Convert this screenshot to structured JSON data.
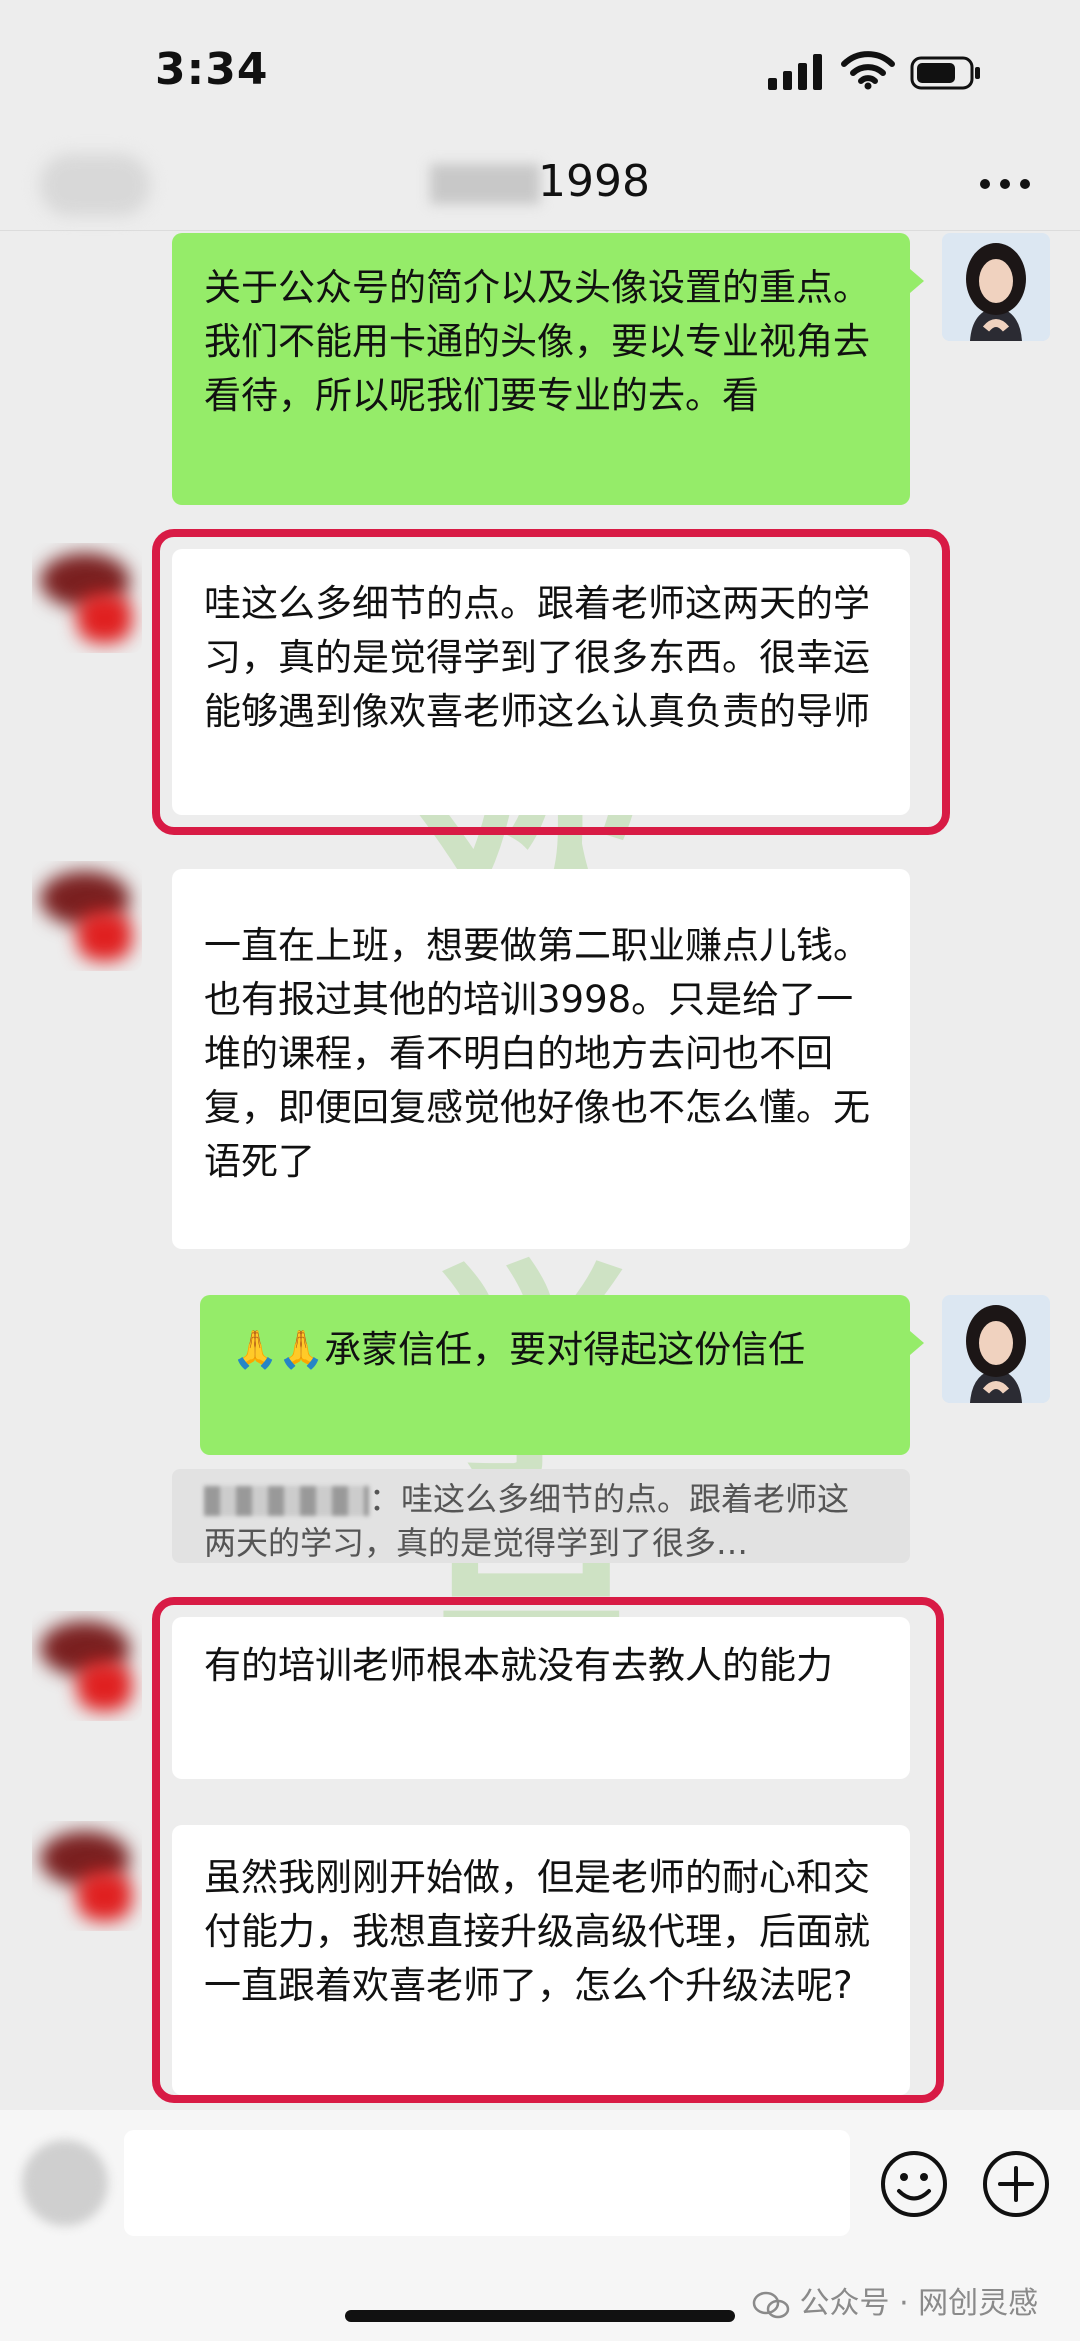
{
  "status_bar": {
    "time": "3:34"
  },
  "header": {
    "title": "1998"
  },
  "messages": [
    {
      "side": "right",
      "text": "关于公众号的简介以及头像设置的重点。我们不能用卡通的头像，要以专业视角去看待，所以呢我们要专业的去。看"
    },
    {
      "side": "left",
      "text": "哇这么多细节的点。跟着老师这两天的学习，真的是觉得学到了很多东西。很幸运能够遇到像欢喜老师这么认真负责的导师"
    },
    {
      "side": "left",
      "text": "一直在上班，想要做第二职业赚点儿钱。也有报过其他的培训3998。只是给了一堆的课程，看不明白的地方去问也不回复，即便回复感觉他好像也不怎么懂。无语死了"
    },
    {
      "side": "right",
      "text": "🙏🙏承蒙信任，要对得起这份信任"
    },
    {
      "side": "left",
      "text": "有的培训老师根本就没有去教人的能力"
    },
    {
      "side": "left",
      "text": "虽然我刚刚开始做，但是老师的耐心和交付能力，我想直接升级高级代理，后面就一直跟着欢喜老师了，怎么个升级法呢?"
    }
  ],
  "quote": {
    "text": "：哇这么多细节的点。跟着老师这两天的学习，真的是觉得学到了很多…"
  },
  "watermark": "欢喜学员",
  "footer": {
    "source": "公众号 · 网创灵感"
  },
  "icons": {
    "signal": "cellular-signal-icon",
    "wifi": "wifi-icon",
    "battery": "battery-icon",
    "more": "more-dots-icon",
    "emoji": "emoji-smile-icon",
    "plus": "plus-circle-icon",
    "wechat": "wechat-logo-icon"
  },
  "colors": {
    "green_bubble": "#95ec69",
    "highlight": "#d81b45",
    "background": "#ededed"
  }
}
